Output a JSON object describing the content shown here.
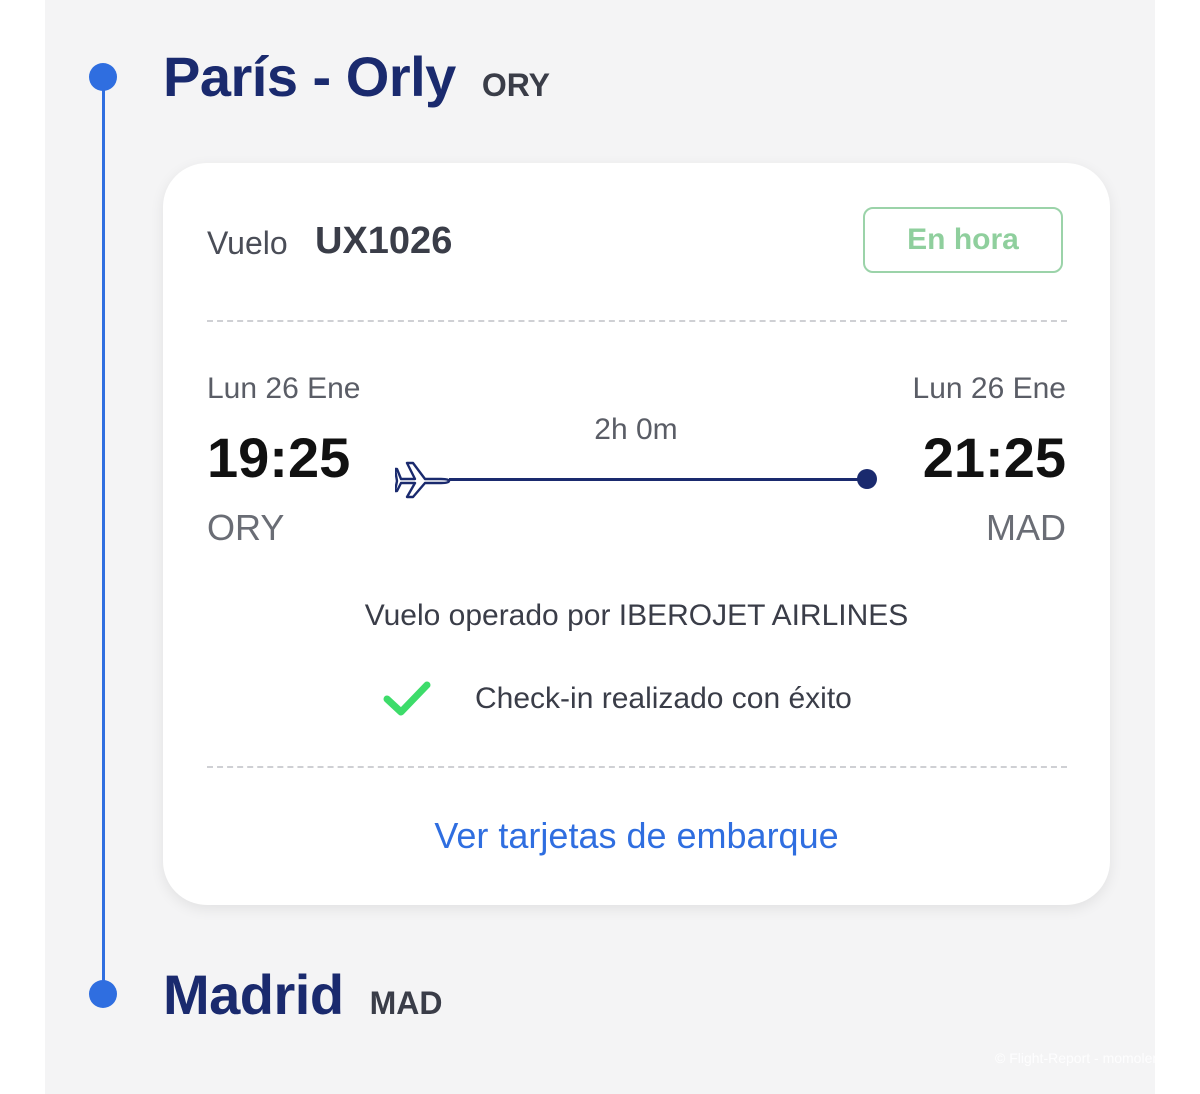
{
  "itinerary": {
    "origin": {
      "name": "París - Orly",
      "code": "ORY"
    },
    "destination": {
      "name": "Madrid",
      "code": "MAD"
    }
  },
  "flight": {
    "label": "Vuelo",
    "number": "UX1026",
    "status": "En hora",
    "status_color": "#8fcf9d",
    "departure": {
      "date": "Lun 26 Ene",
      "time": "19:25",
      "code": "ORY"
    },
    "arrival": {
      "date": "Lun 26 Ene",
      "time": "21:25",
      "code": "MAD"
    },
    "duration": "2h 0m",
    "operated_by": "Vuelo operado por IBEROJET AIRLINES",
    "checkin_status": "Check-in realizado con éxito",
    "boarding_link": "Ver tarjetas de embarque"
  },
  "icons": {
    "plane": "airplane-icon",
    "check": "checkmark-icon"
  },
  "colors": {
    "accent": "#2f6ee0",
    "navy": "#1a2a6e",
    "success": "#3ddc6a"
  },
  "watermark": "© Flight-Report - momolemom"
}
